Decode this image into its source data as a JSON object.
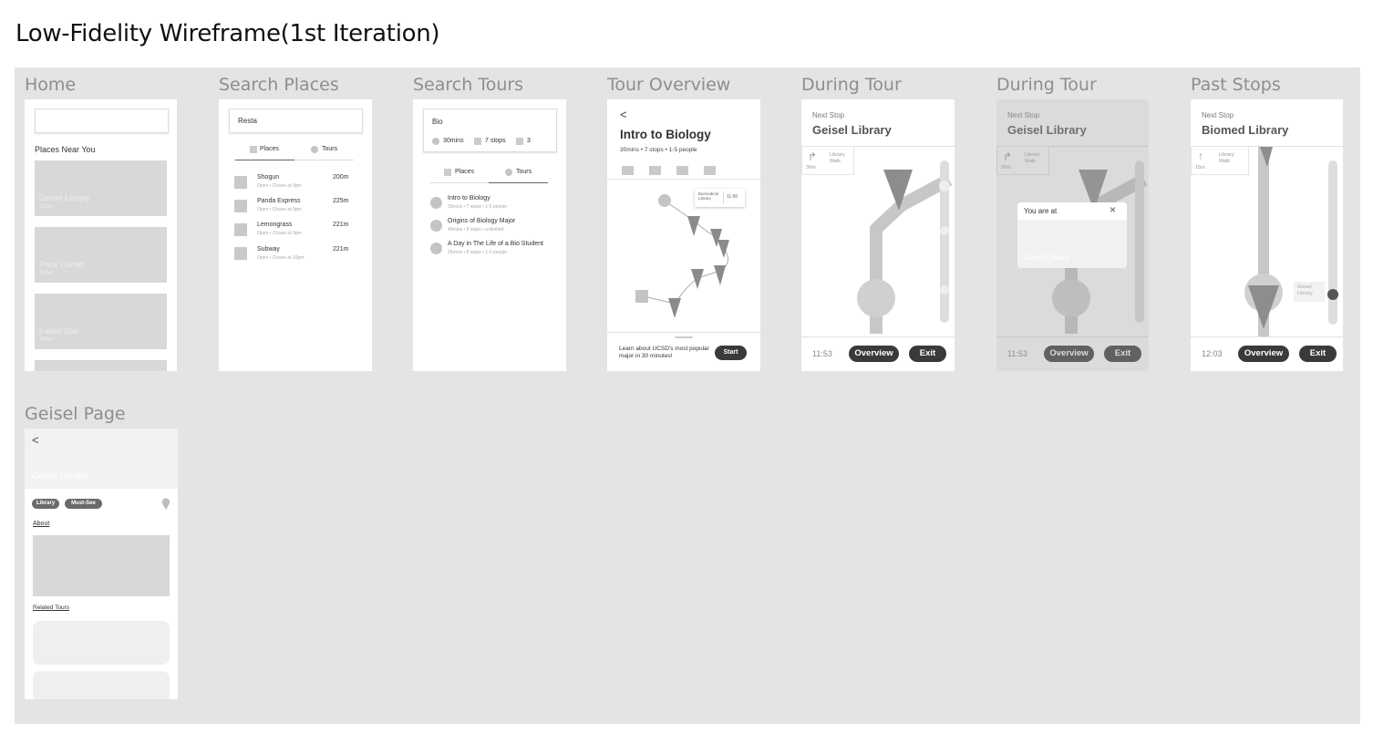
{
  "title": "Low-Fidelity Wireframe(1st Iteration)",
  "frames": {
    "home": {
      "label": "Home",
      "section": "Places Near You",
      "cards": [
        {
          "name": "Geisel Library",
          "dist": "x10m"
        },
        {
          "name": "Price Center",
          "dist": "200m"
        },
        {
          "name": "Fallen Star",
          "dist": "400m"
        }
      ]
    },
    "search_places": {
      "label": "Search Places",
      "query": "Resta",
      "tabs": [
        "Places",
        "Tours"
      ],
      "results": [
        {
          "name": "Shogun",
          "meta": "Open  • Closes at 9pm",
          "dist": "200m"
        },
        {
          "name": "Panda Express",
          "meta": "Open  • Closes at 9pm",
          "dist": "225m"
        },
        {
          "name": "Lemongrass",
          "meta": "Open  • Closes at 9pm",
          "dist": "221m"
        },
        {
          "name": "Subway",
          "meta": "Open  • Closes at 10pm",
          "dist": "221m"
        }
      ]
    },
    "search_tours": {
      "label": "Search Tours",
      "query": "Bio",
      "filters": [
        "30mins",
        "7 stops",
        "3"
      ],
      "tabs": [
        "Places",
        "Tours"
      ],
      "results": [
        {
          "name": "Intro to Biology",
          "meta": "30mins  •  7 stops  •  1-5 people"
        },
        {
          "name": "Origins of Biology Major",
          "meta": "40mins  •  8 stops  •  unlimited"
        },
        {
          "name": "A Day in The Life of a Bio Student",
          "meta": "25mins  •  8 stops  •  1-2 people"
        }
      ]
    },
    "tour_overview": {
      "label": "Tour Overview",
      "back": "<",
      "title": "Intro to Biology",
      "meta": "30mins  •  7 stops  •  1-5 people",
      "popup_label": "Biomedical Library",
      "popup_time": "11:50",
      "description": "Learn about UCSD's most popular major in 30 minutes!",
      "start": "Start"
    },
    "during_tour_1": {
      "label": "During Tour",
      "next_stop_label": "Next Stop",
      "stop_name": "Geisel Library",
      "direction": "Library Walk",
      "distance": "30m",
      "time": "11:53",
      "overview": "Overview",
      "exit": "Exit"
    },
    "during_tour_2": {
      "label": "During Tour",
      "next_stop_label": "Next Stop",
      "stop_name": "Geisel Library",
      "direction": "Library Walk",
      "distance": "30m",
      "modal_title": "You are at",
      "modal_place": "Geisel Library",
      "time": "11:53",
      "overview": "Overview",
      "exit": "Exit"
    },
    "past_stops": {
      "label": "Past Stops",
      "next_stop_label": "Next Stop",
      "stop_name": "Biomed Library",
      "direction": "Library Walk",
      "distance": "15m",
      "side_label": "Geisel Library",
      "time": "12:03",
      "overview": "Overview",
      "exit": "Exit"
    },
    "geisel_page": {
      "label": "Geisel Page",
      "back": "<",
      "hero_title": "Geisel Library",
      "tags": [
        "Library",
        "Must-See"
      ],
      "about": "About",
      "related": "Related Tours"
    }
  }
}
